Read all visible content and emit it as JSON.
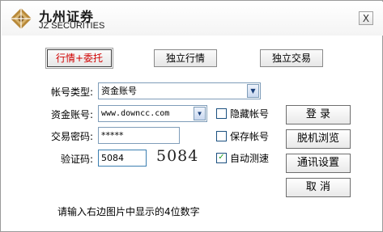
{
  "brand": {
    "name_cn": "九州证券",
    "name_en": "JZ SECURITIES"
  },
  "window": {
    "close_label": "X"
  },
  "tabs": [
    {
      "label": "行情+委托",
      "active": true
    },
    {
      "label": "独立行情",
      "active": false
    },
    {
      "label": "独立交易",
      "active": false
    }
  ],
  "form": {
    "account_type": {
      "label": "帐号类型:",
      "value": "资金账号"
    },
    "account": {
      "label": "资金账号:",
      "value": "www.downcc.com"
    },
    "password": {
      "label": "交易密码:",
      "value": "*****"
    },
    "captcha": {
      "label": "验证码:",
      "value": "5084",
      "image_text": "5084"
    }
  },
  "options": {
    "hide_account": {
      "label": "隐藏帐号",
      "checked": false
    },
    "save_account": {
      "label": "保存帐号",
      "checked": false
    },
    "auto_speed_test": {
      "label": "自动测速",
      "checked": true
    }
  },
  "buttons": {
    "login": "登  录",
    "offline_browse": "脱机浏览",
    "comm_settings": "通讯设置",
    "cancel": "取  消"
  },
  "hint": "请输入右边图片中显示的4位数字",
  "colors": {
    "active_tab_text": "#d00000",
    "check_mark": "#21a121",
    "logo_gold": "#b8893a"
  }
}
